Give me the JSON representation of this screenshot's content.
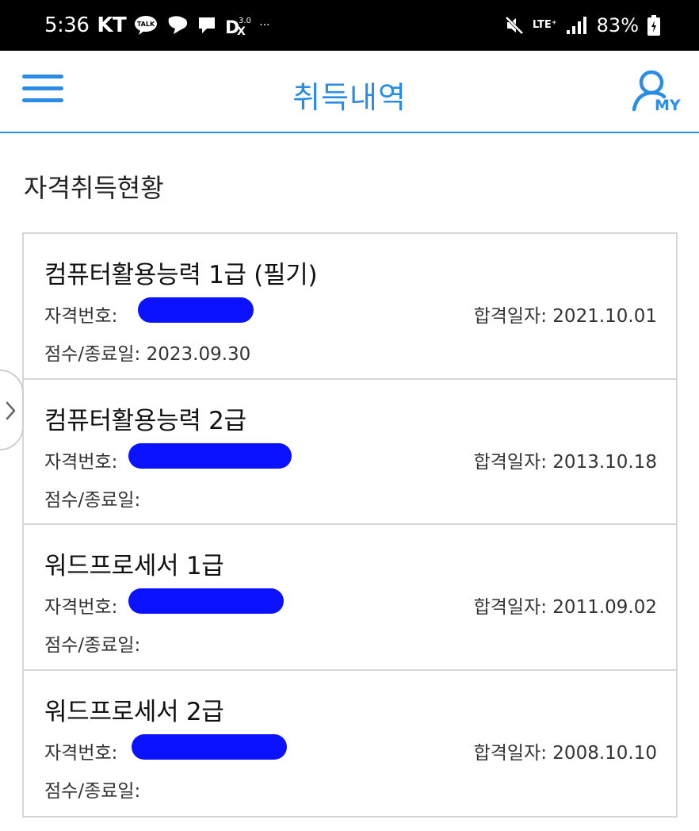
{
  "status_bar": {
    "time": "5:36",
    "carrier": "KT",
    "more": "···",
    "battery_percent": "83%",
    "network_type": "LTE⁺",
    "icons": [
      "kakaotalk-icon",
      "chat-bubble-icon",
      "message-icon",
      "dx-icon",
      "mute-icon",
      "lte-icon",
      "signal-icon",
      "battery-icon"
    ]
  },
  "appbar": {
    "title": "취득내역",
    "menu_icon": "hamburger-menu-icon",
    "my_icon": "my-account-icon",
    "my_label": "MY",
    "accent_color": "#2b8ce6"
  },
  "section": {
    "title": "자격취득현황"
  },
  "certificates": [
    {
      "name": "컴퓨터활용능력 1급 (필기)",
      "license_label": "자격번호:",
      "pass_date_label": "합격일자:",
      "pass_date": "2021.10.01",
      "score_label": "점수/종료일:",
      "score_value": "2023.09.30"
    },
    {
      "name": "컴퓨터활용능력 2급",
      "license_label": "자격번호:",
      "pass_date_label": "합격일자:",
      "pass_date": "2013.10.18",
      "score_label": "점수/종료일:",
      "score_value": ""
    },
    {
      "name": "워드프로세서 1급",
      "license_label": "자격번호:",
      "pass_date_label": "합격일자:",
      "pass_date": "2011.09.02",
      "score_label": "점수/종료일:",
      "score_value": ""
    },
    {
      "name": "워드프로세서 2급",
      "license_label": "자격번호:",
      "pass_date_label": "합격일자:",
      "pass_date": "2008.10.10",
      "score_label": "점수/종료일:",
      "score_value": ""
    }
  ],
  "redaction_color": "#0a12ff"
}
